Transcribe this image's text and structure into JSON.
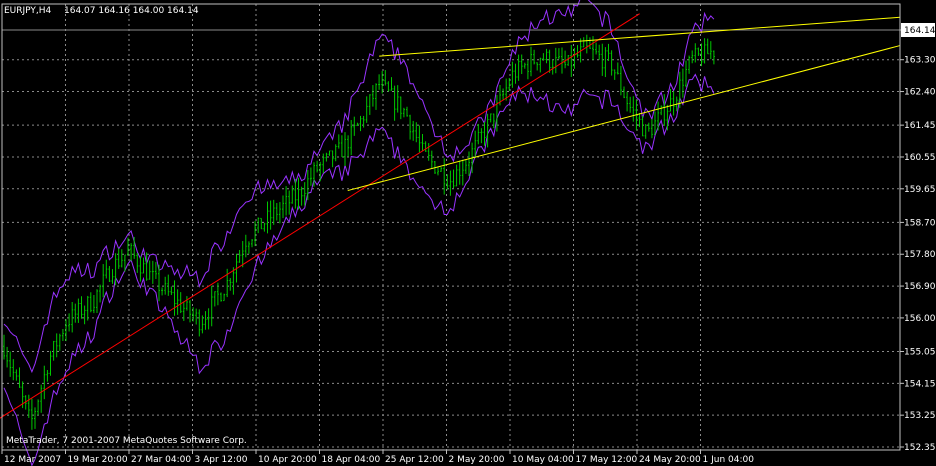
{
  "window": {
    "symbol_label": "EURJPY,H4",
    "ohlc": "164.07 164.16 164.00 164.14",
    "copyright": "MetaTrader, 7 2001-2007 MetaQuotes Software Corp."
  },
  "colors": {
    "background": "#000000",
    "grid": "#8a8a8a",
    "axis": "#c0c0c0",
    "candles": "#00c800",
    "bands": "#9933ff",
    "trend_red": "#ff0000",
    "trend_yellow": "#ffff00",
    "last_price_tag": "#ffffff"
  },
  "chart_data": {
    "type": "line",
    "symbol": "EURJPY",
    "timeframe": "H4",
    "last_price": 164.14,
    "grid": true,
    "x_tick_labels": [
      "12 Mar 2007",
      "19 Mar 20:00",
      "27 Mar 04:00",
      "3 Apr 12:00",
      "10 Apr 20:00",
      "18 Apr 04:00",
      "25 Apr 12:00",
      "2 May 20:00",
      "10 May 04:00",
      "17 May 12:00",
      "24 May 20:00",
      "1 Jun 04:00"
    ],
    "y_tick_labels": [
      "164.14",
      "163.30",
      "162.40",
      "161.45",
      "160.55",
      "159.65",
      "158.70",
      "157.80",
      "156.90",
      "156.00",
      "155.05",
      "154.15",
      "153.25",
      "152.35"
    ],
    "ylim": [
      152.35,
      164.6
    ],
    "close_path": {
      "x": [
        0,
        3,
        5,
        7,
        10,
        12,
        14,
        17,
        20,
        22,
        25,
        27,
        30,
        33,
        35,
        38,
        40,
        42,
        45,
        47,
        50,
        52,
        55,
        57,
        60,
        63,
        65,
        68,
        70,
        72,
        75,
        77,
        80,
        82,
        84,
        86,
        88,
        90,
        92,
        95,
        97,
        100
      ],
      "y": [
        155.2,
        153.0,
        154.8,
        155.9,
        156.5,
        157.4,
        157.9,
        157.0,
        156.3,
        155.9,
        157.0,
        158.2,
        158.9,
        159.5,
        160.2,
        160.8,
        161.6,
        162.6,
        161.8,
        160.6,
        159.9,
        160.5,
        161.8,
        162.9,
        163.4,
        163.1,
        163.6,
        163.2,
        162.0,
        161.2,
        162.2,
        163.3,
        163.6,
        163.1,
        163.8,
        163.4,
        163.5,
        162.7,
        163.2,
        163.9,
        163.4,
        164.14
      ]
    },
    "overlays": [
      {
        "kind": "trendline",
        "color": "red",
        "x": [
          -5,
          71
        ],
        "y": [
          152.4,
          164.6
        ]
      },
      {
        "kind": "trendline",
        "color": "yellow",
        "x": [
          38.5,
          100
        ],
        "y": [
          159.6,
          163.7
        ]
      },
      {
        "kind": "trendline",
        "color": "yellow",
        "x": [
          42,
          100
        ],
        "y": [
          163.4,
          164.5
        ]
      }
    ]
  }
}
